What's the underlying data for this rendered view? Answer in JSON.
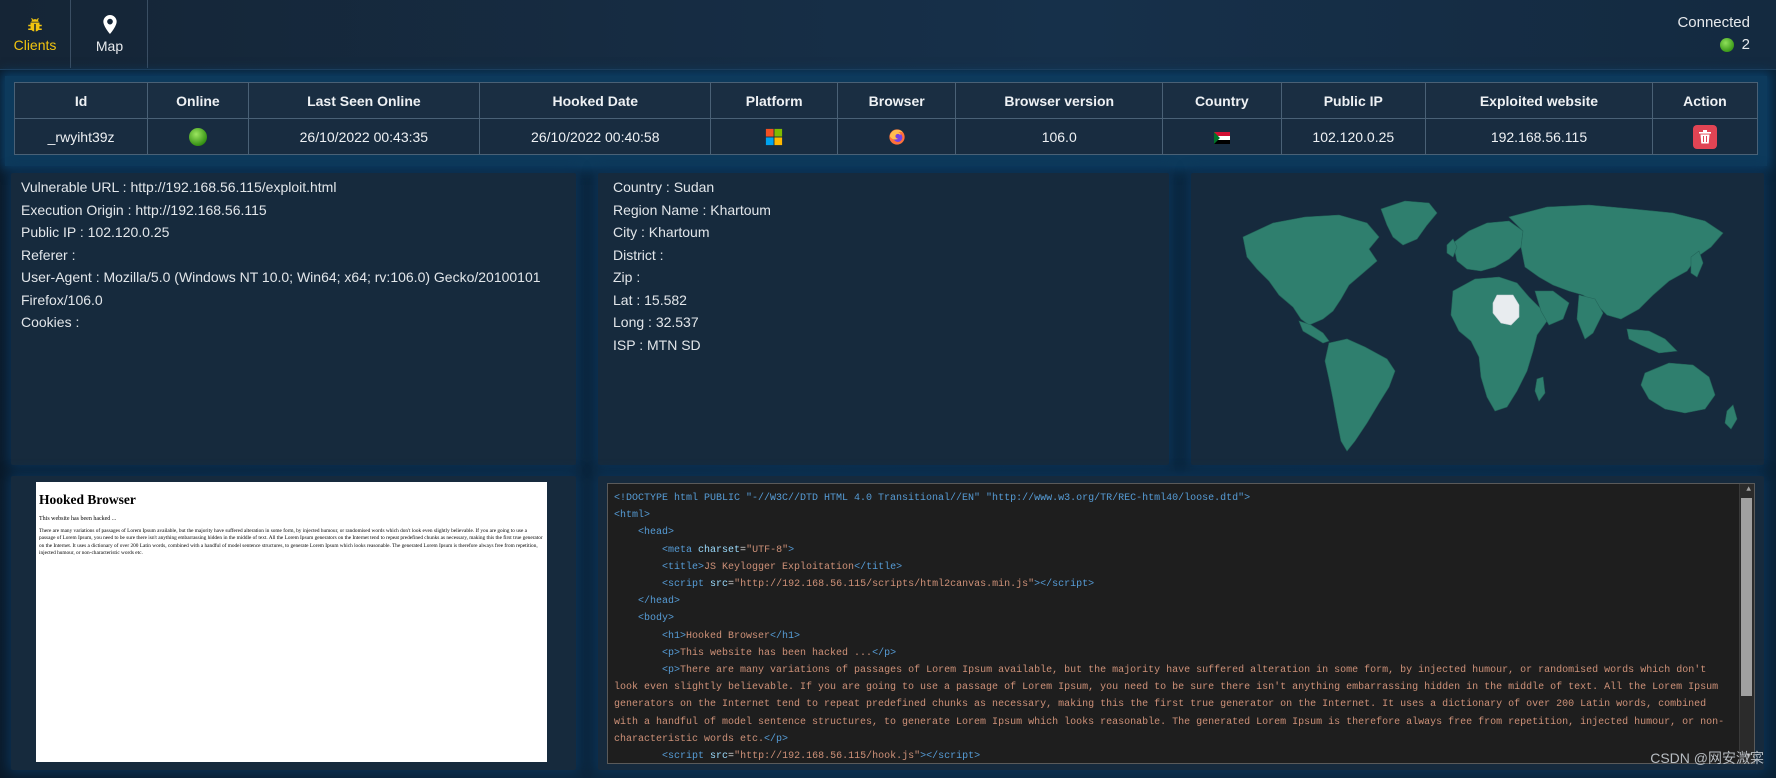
{
  "nav": {
    "clients_label": "Clients",
    "map_label": "Map"
  },
  "connection": {
    "label": "Connected",
    "count": "2"
  },
  "table": {
    "headers": [
      "Id",
      "Online",
      "Last Seen Online",
      "Hooked Date",
      "Platform",
      "Browser",
      "Browser version",
      "Country",
      "Public IP",
      "Exploited website",
      "Action"
    ],
    "row": {
      "id": "_rwyiht39z",
      "last_seen": "26/10/2022 00:43:35",
      "hooked_date": "26/10/2022 00:40:58",
      "browser_version": "106.0",
      "public_ip": "102.120.0.25",
      "exploited_website": "192.168.56.115"
    }
  },
  "client_info": [
    "Vulnerable URL : http://192.168.56.115/exploit.html",
    "Execution Origin : http://192.168.56.115",
    "Public IP : 102.120.0.25",
    "Referer :",
    "User-Agent : Mozilla/5.0 (Windows NT 10.0; Win64; x64; rv:106.0) Gecko/20100101",
    "Firefox/106.0",
    "Cookies :"
  ],
  "geo_info": [
    "Country : Sudan",
    "Region Name : Khartoum",
    "City : Khartoum",
    "District :",
    "Zip :",
    "Lat : 15.582",
    "Long : 32.537",
    "ISP : MTN SD"
  ],
  "screenshot": {
    "title": "Hooked Browser",
    "line1": "This website has been hacked ...",
    "paragraph": "There are many variations of passages of Lorem Ipsum available, but the majority have suffered alteration in some form, by injected humour, or randomised words which don't look even slightly believable. If you are going to use a passage of Lorem Ipsum, you need to be sure there isn't anything embarrassing hidden in the middle of text. All the Lorem Ipsum generators on the Internet tend to repeat predefined chunks as necessary, making this the first true generator on the Internet. It uses a dictionary of over 200 Latin words, combined with a handful of model sentence structures, to generate Lorem Ipsum which looks reasonable. The generated Lorem Ipsum is therefore always free from repetition, injected humour, or non-characteristic words etc."
  },
  "code": {
    "doctype": "<!DOCTYPE html PUBLIC \"-//W3C//DTD HTML 4.0 Transitional//EN\" \"http://www.w3.org/TR/REC-html40/loose.dtd\">",
    "charset": "\"UTF-8\"",
    "title": "JS Keylogger Exploitation",
    "script1_src": "\"http://192.168.56.115/scripts/html2canvas.min.js\"",
    "h1": "Hooked Browser",
    "p1": "This website has been hacked ...",
    "p2": "There are many variations of passages of Lorem Ipsum available, but the majority have suffered alteration in some form, by injected humour, or randomised words which don't look even slightly believable. If you are going to use a passage of Lorem Ipsum, you need to be sure there isn't anything embarrassing hidden in the middle of text. All the Lorem Ipsum generators on the Internet tend to repeat predefined chunks as necessary, making this the first true generator on the Internet. It uses a dictionary of over 200 Latin words, combined with a handful of model sentence structures, to generate Lorem Ipsum which looks reasonable. The generated Lorem Ipsum is therefore always free from repetition, injected humour, or non-characteristic words etc.",
    "script2_src": "\"http://192.168.56.115/hook.js\""
  },
  "watermark": "CSDN @网安溦寀",
  "colors": {
    "accent": "#f1c40f",
    "map_land": "#2f7f6e",
    "map_highlight": "#e8ecef",
    "delete": "#e14454",
    "online": "#5cc22b"
  }
}
